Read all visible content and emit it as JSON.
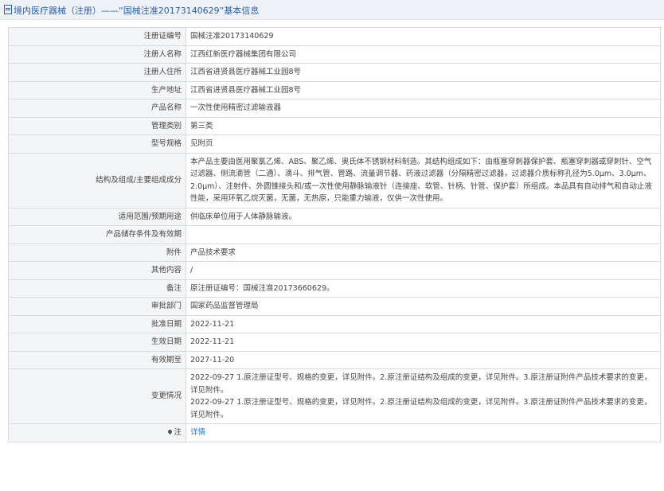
{
  "header": {
    "title": "境内医疗器械（注册）——“国械注准20173140629”基本信息"
  },
  "rows": [
    {
      "label": "注册证编号",
      "value": "国械注准20173140629"
    },
    {
      "label": "注册人名称",
      "value": "江西红新医疗器械集团有限公司"
    },
    {
      "label": "注册人住所",
      "value": "江西省进贤县医疗器械工业园8号"
    },
    {
      "label": "生产地址",
      "value": "江西省进贤县医疗器械工业园8号"
    },
    {
      "label": "产品名称",
      "value": "一次性使用精密过滤输液器"
    },
    {
      "label": "管理类别",
      "value": "第三类"
    },
    {
      "label": "型号规格",
      "value": "见附页"
    },
    {
      "label": "结构及组成/主要组成成分",
      "value": "本产品主要由医用聚氯乙烯、ABS、聚乙烯、奥氏体不锈钢材料制造。其结构组成如下：由瓶塞穿刺器保护套、瓶塞穿刺器或穿刺针、空气过滤器、侧流滴管（二通）、滴斗、排气管、管路、流量调节器、药液过滤器（分隔精密过滤器，过滤器介质标称孔径为5.0μm、3.0μm、2.0μm）、注射件、外圆锥接头和/或一次性使用静脉输液针（连接座、软管、针柄、针管、保护套）所组成。本品具有自动排气和自动止液性能，采用环氧乙烷灭菌，无菌，无热原，只能重力输液，仅供一次性使用。"
    },
    {
      "label": "适用范围/预期用途",
      "value": "供临床单位用于人体静脉输液。"
    },
    {
      "label": "产品储存条件及有效期",
      "value": ""
    },
    {
      "label": "附件",
      "value": "产品技术要求"
    },
    {
      "label": "其他内容",
      "value": "/"
    },
    {
      "label": "备注",
      "value": "原注册证编号：国械注准20173660629。"
    },
    {
      "label": "审批部门",
      "value": "国家药品监督管理局"
    },
    {
      "label": "批准日期",
      "value": "2022-11-21"
    },
    {
      "label": "生效日期",
      "value": "2022-11-21"
    },
    {
      "label": "有效期至",
      "value": "2027-11-20"
    }
  ],
  "changes": {
    "label": "变更情况",
    "entries": [
      "2022-09-27 1.原注册证型号、规格的变更，详见附件。2.原注册证结构及组成的变更，详见附件。3.原注册证附件产品技术要求的变更，详见附件。",
      "2022-09-27 1.原注册证型号、规格的变更，详见附件。2.原注册证结构及组成的变更，详见附件。3.原注册证附件产品技术要求的变更，详见附件。"
    ]
  },
  "note": {
    "label": "注",
    "link_text": "详情"
  }
}
